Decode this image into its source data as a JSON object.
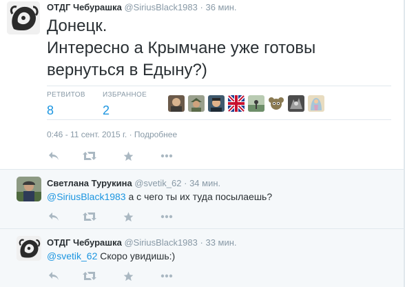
{
  "main_tweet": {
    "fullname": "ОТДГ Чебурашка",
    "handle": "@SiriusBlack1983",
    "separator": "·",
    "time": "36 мин.",
    "text_lines": [
      "Донецк.",
      "Интересно а Крымчане уже готовы",
      "вернуться в Едыну?)"
    ],
    "retweets_label": "РЕТВИТОВ",
    "retweets_count": "8",
    "favorites_label": "ИЗБРАННОЕ",
    "favorites_count": "2",
    "timestamp": "0:46 - 11 сент. 2015 г.",
    "details_link": "Подробнее"
  },
  "replies": [
    {
      "fullname": "Светлана Турукина",
      "handle": "@svetik_62",
      "separator": "·",
      "time": "34 мин.",
      "mention": "@SiriusBlack1983",
      "text": " а с чего ты их туда посылаешь?"
    },
    {
      "fullname": "ОТДГ Чебурашка",
      "handle": "@SiriusBlack1983",
      "separator": "·",
      "time": "33 мин.",
      "mention": "@svetik_62",
      "text": " Скоро увидишь:)"
    }
  ],
  "icons": {
    "reply": "reply-icon",
    "retweet": "retweet-icon",
    "favorite": "star-icon",
    "more": "more-icon"
  },
  "colors": {
    "link": "#1b95e0",
    "muted": "#8899a6",
    "reply_background": "#f5f8fa"
  }
}
